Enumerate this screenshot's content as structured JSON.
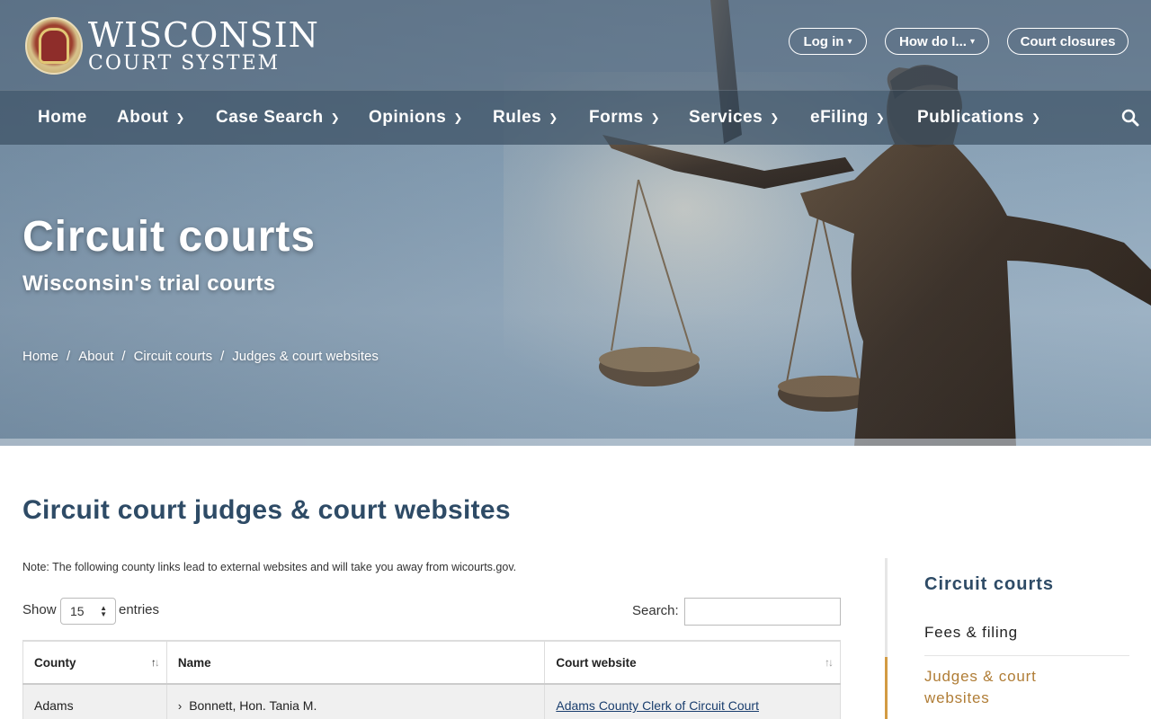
{
  "brand": {
    "line1": "WISCONSIN",
    "line2": "COURT SYSTEM"
  },
  "top_buttons": {
    "login": "Log in",
    "how_do_i": "How do I...",
    "court_closures": "Court closures"
  },
  "nav": {
    "items": [
      {
        "label": "Home",
        "has_menu": false
      },
      {
        "label": "About",
        "has_menu": true
      },
      {
        "label": "Case Search",
        "has_menu": true
      },
      {
        "label": "Opinions",
        "has_menu": true
      },
      {
        "label": "Rules",
        "has_menu": true
      },
      {
        "label": "Forms",
        "has_menu": true
      },
      {
        "label": "Services",
        "has_menu": true
      },
      {
        "label": "eFiling",
        "has_menu": true
      },
      {
        "label": "Publications",
        "has_menu": true
      }
    ]
  },
  "hero": {
    "title": "Circuit courts",
    "subtitle": "Wisconsin's trial courts"
  },
  "breadcrumb": [
    "Home",
    "About",
    "Circuit courts",
    "Judges & court websites"
  ],
  "main": {
    "title": "Circuit court judges & court websites",
    "note": "Note: The following county links lead to external websites and will take you away from wicourts.gov.",
    "show_label": "Show",
    "show_value": "15",
    "entries_label": "entries",
    "search_label": "Search:",
    "search_value": ""
  },
  "table": {
    "headers": [
      "County",
      "Name",
      "Court website"
    ],
    "rows": [
      {
        "county": "Adams",
        "name": "Bonnett, Hon. Tania M.",
        "website": "Adams County Clerk of Circuit Court"
      }
    ]
  },
  "sidebar": {
    "title": "Circuit courts",
    "items": [
      "Fees & filing",
      "Judges & court websites"
    ]
  },
  "colors": {
    "accent": "#d39b43",
    "heading": "#2e4b66",
    "link": "#1a3e6e"
  },
  "icons": {
    "search": "search-icon",
    "chevron": "chevron-down-icon",
    "sort": "sort-icon"
  }
}
